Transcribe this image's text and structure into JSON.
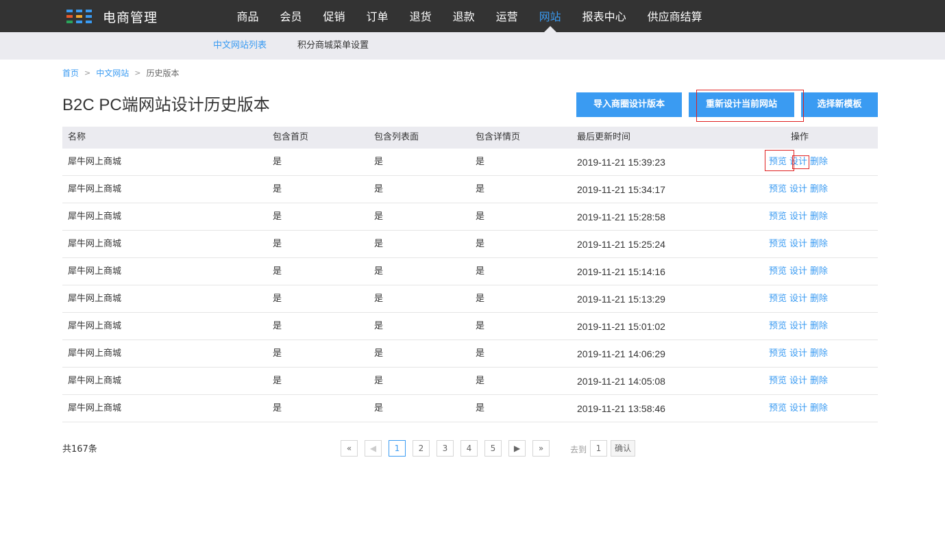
{
  "app": {
    "logo_text": "电商管理",
    "logo_colors": [
      "#3a9bf2",
      "#3a9bf2",
      "#3a9bf2",
      "#e8582b",
      "#f0a830",
      "#3a9bf2",
      "#2aa55b",
      "#3a9bf2",
      "#3a9bf2"
    ]
  },
  "nav": {
    "items": [
      "商品",
      "会员",
      "促销",
      "订单",
      "退货",
      "退款",
      "运营",
      "网站",
      "报表中心",
      "供应商结算"
    ],
    "active": "网站"
  },
  "subnav": {
    "items": [
      "中文网站列表",
      "积分商城菜单设置"
    ],
    "active": "中文网站列表"
  },
  "breadcrumb": {
    "home": "首页",
    "section": "中文网站",
    "current": "历史版本",
    "separator": ">"
  },
  "page": {
    "title": "B2C PC端网站设计历史版本"
  },
  "actions": {
    "import_label": "导入商圈设计版本",
    "redesign_label": "重新设计当前网站",
    "new_template_label": "选择新模板"
  },
  "table": {
    "headers": {
      "name": "名称",
      "home": "包含首页",
      "list": "包含列表面",
      "detail": "包含详情页",
      "time": "最后更新时间",
      "op": "操作"
    },
    "op_labels": {
      "preview": "预览",
      "design": "设计",
      "delete": "删除"
    },
    "rows": [
      {
        "name": "犀牛网上商城",
        "home": "是",
        "list": "是",
        "detail": "是",
        "time": "2019-11-21 15:39:23"
      },
      {
        "name": "犀牛网上商城",
        "home": "是",
        "list": "是",
        "detail": "是",
        "time": "2019-11-21 15:34:17"
      },
      {
        "name": "犀牛网上商城",
        "home": "是",
        "list": "是",
        "detail": "是",
        "time": "2019-11-21 15:28:58"
      },
      {
        "name": "犀牛网上商城",
        "home": "是",
        "list": "是",
        "detail": "是",
        "time": "2019-11-21 15:25:24"
      },
      {
        "name": "犀牛网上商城",
        "home": "是",
        "list": "是",
        "detail": "是",
        "time": "2019-11-21 15:14:16"
      },
      {
        "name": "犀牛网上商城",
        "home": "是",
        "list": "是",
        "detail": "是",
        "time": "2019-11-21 15:13:29"
      },
      {
        "name": "犀牛网上商城",
        "home": "是",
        "list": "是",
        "detail": "是",
        "time": "2019-11-21 15:01:02"
      },
      {
        "name": "犀牛网上商城",
        "home": "是",
        "list": "是",
        "detail": "是",
        "time": "2019-11-21 14:06:29"
      },
      {
        "name": "犀牛网上商城",
        "home": "是",
        "list": "是",
        "detail": "是",
        "time": "2019-11-21 14:05:08"
      },
      {
        "name": "犀牛网上商城",
        "home": "是",
        "list": "是",
        "detail": "是",
        "time": "2019-11-21 13:58:46"
      }
    ]
  },
  "footer": {
    "total": "共167条",
    "pager": {
      "first": "«",
      "prev": "◀",
      "pages": [
        "1",
        "2",
        "3",
        "4",
        "5"
      ],
      "current": "1",
      "next": "▶",
      "last": "»"
    },
    "goto_label": "去到",
    "goto_value": "1",
    "confirm_label": "确认"
  },
  "colors": {
    "accent": "#3a9bf2",
    "topbar": "#333333",
    "subnav": "#ebebf0",
    "highlight": "#e02020"
  }
}
